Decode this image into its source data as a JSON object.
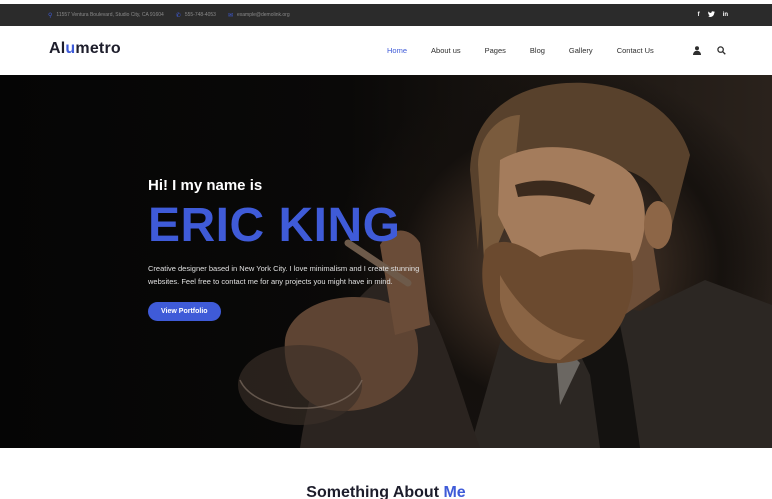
{
  "topbar": {
    "address": "11557 Ventura Boulevard, Studio City, CA 91604",
    "phone": "555-748-4053",
    "email": "example@demolink.org"
  },
  "header": {
    "logo_primary": "Al",
    "logo_accent": "u",
    "logo_rest": "metro",
    "nav": {
      "home": "Home",
      "about": "About us",
      "pages": "Pages",
      "blog": "Blog",
      "gallery": "Gallery",
      "contact": "Contact Us"
    }
  },
  "hero": {
    "greeting": "Hi! I my name is",
    "name": "ERIC KING",
    "description": "Creative designer based in New York City. I love minimalism and I create stunning websites. Feel free to contact me for any projects you might have in mind.",
    "button_label": "View Portfolio"
  },
  "about": {
    "heading_main": "Something About",
    "heading_accent": "Me"
  },
  "colors": {
    "accent": "#3f5bd8",
    "topbar_bg": "#2b2b2b",
    "logo_dark": "#1d1d2b"
  },
  "icons": {
    "topbar": [
      "location-pin-icon",
      "phone-icon",
      "mail-icon"
    ],
    "social": [
      "facebook-icon",
      "twitter-icon",
      "linkedin-icon"
    ],
    "nav": [
      "user-icon",
      "search-icon"
    ]
  }
}
